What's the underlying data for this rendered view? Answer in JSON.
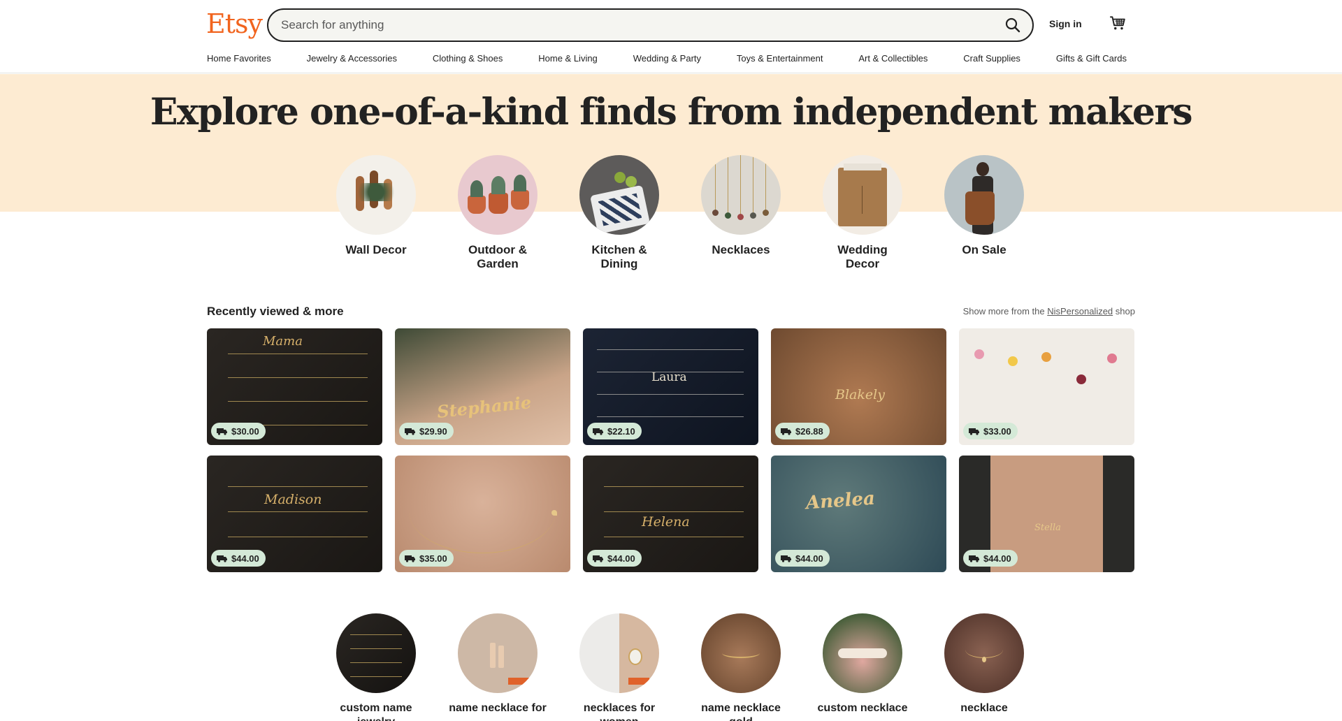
{
  "header": {
    "logo": "Etsy",
    "search_placeholder": "Search for anything",
    "signin_label": "Sign in"
  },
  "nav": [
    "Home Favorites",
    "Jewelry & Accessories",
    "Clothing & Shoes",
    "Home & Living",
    "Wedding & Party",
    "Toys & Entertainment",
    "Art & Collectibles",
    "Craft Supplies",
    "Gifts & Gift Cards"
  ],
  "hero": {
    "title": "Explore one-of-a-kind finds from independent makers",
    "categories": [
      {
        "label": "Wall Decor"
      },
      {
        "label": "Outdoor & Garden"
      },
      {
        "label": "Kitchen & Dining"
      },
      {
        "label": "Necklaces"
      },
      {
        "label": "Wedding Decor"
      },
      {
        "label": "On Sale"
      }
    ]
  },
  "recent": {
    "title": "Recently viewed & more",
    "more_prefix": "Show more from the",
    "shop_name": "NisPersonalized",
    "more_suffix": "shop",
    "items": [
      {
        "price": "$30.00",
        "overlay": "Mama"
      },
      {
        "price": "$29.90",
        "overlay": "Stephanie"
      },
      {
        "price": "$22.10",
        "overlay": "Laura"
      },
      {
        "price": "$26.88",
        "overlay": "Blakely"
      },
      {
        "price": "$33.00",
        "overlay": ""
      },
      {
        "price": "$44.00",
        "overlay": "Madison"
      },
      {
        "price": "$35.00",
        "overlay": ""
      },
      {
        "price": "$44.00",
        "overlay": "Helena"
      },
      {
        "price": "$44.00",
        "overlay": "Anelea"
      },
      {
        "price": "$44.00",
        "overlay": "Stella"
      }
    ]
  },
  "searches": [
    {
      "label": "custom name jewelry"
    },
    {
      "label": "name necklace for"
    },
    {
      "label": "necklaces for women"
    },
    {
      "label": "name necklace gold"
    },
    {
      "label": "custom necklace"
    },
    {
      "label": "necklace"
    }
  ],
  "colors": {
    "brand": "#f1641e",
    "hero_bg": "#fdebd2",
    "price_badge": "#d4e9d7"
  }
}
